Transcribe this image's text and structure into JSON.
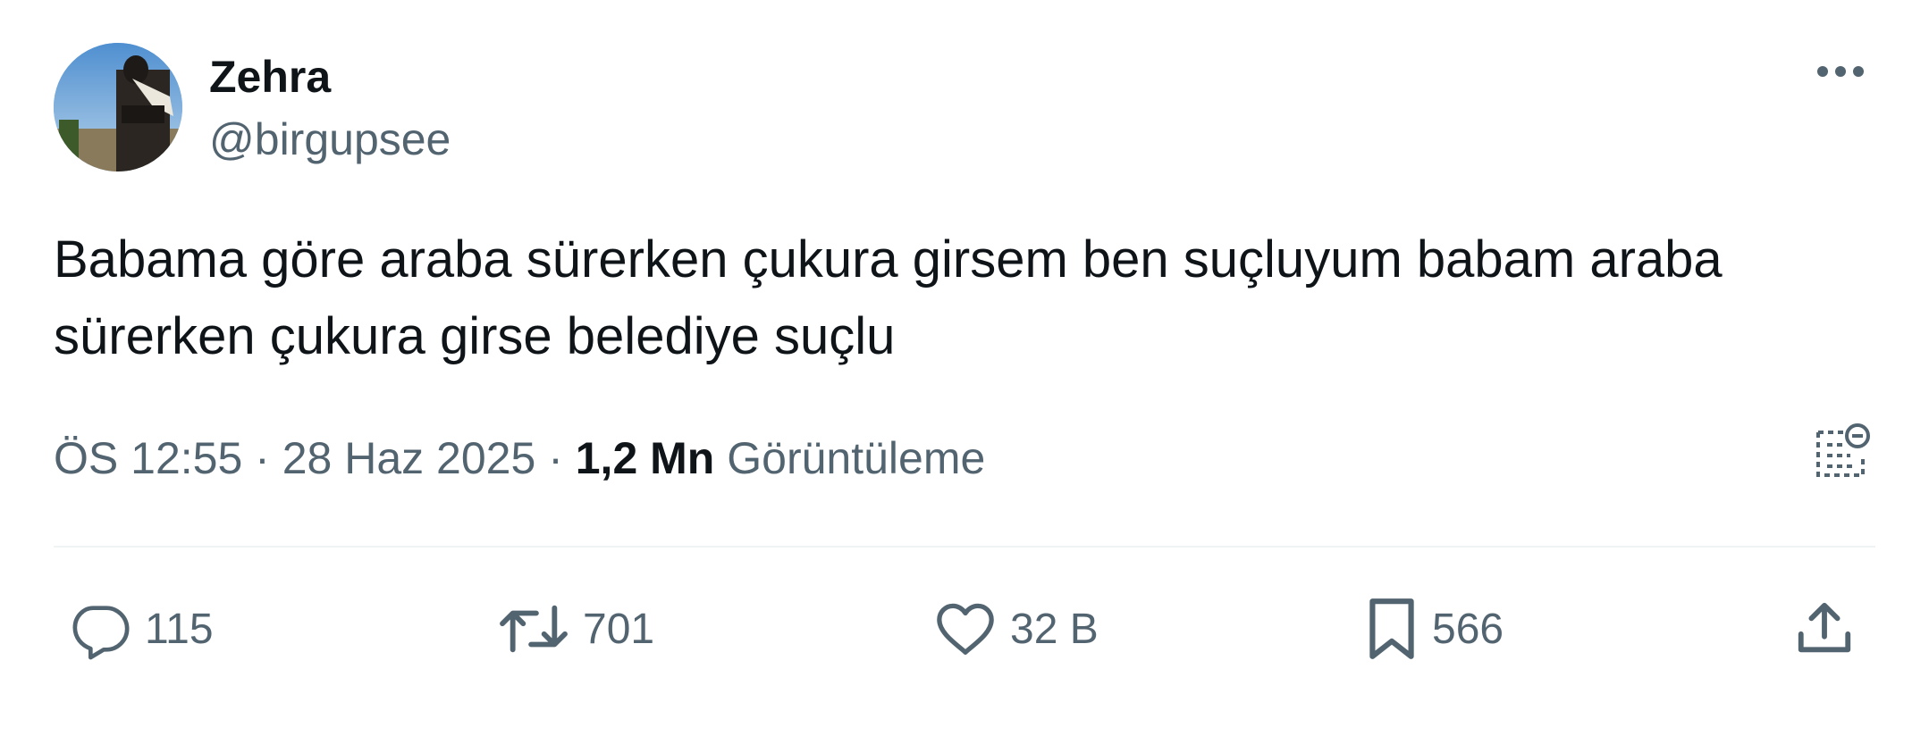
{
  "author": {
    "display_name": "Zehra",
    "handle": "@birgupsee",
    "avatar_icon": "profile-photo"
  },
  "tweet": {
    "text": "Babama göre araba sürerken çukura girsem ben suçluyum babam araba sürerken çukura girse belediye suçlu"
  },
  "meta": {
    "time": "ÖS 12:55",
    "separator": "·",
    "date": "28 Haz 2025",
    "views_count": "1,2 Mn",
    "views_label": "Görüntüleme"
  },
  "actions": {
    "reply": {
      "icon": "reply-icon",
      "count": "115"
    },
    "retweet": {
      "icon": "retweet-icon",
      "count": "701"
    },
    "like": {
      "icon": "heart-icon",
      "count": "32 B"
    },
    "bookmark": {
      "icon": "bookmark-icon",
      "count": "566"
    },
    "share": {
      "icon": "share-icon"
    }
  },
  "colors": {
    "text_primary": "#0f1419",
    "text_secondary": "#536471",
    "divider": "#eff3f4"
  }
}
